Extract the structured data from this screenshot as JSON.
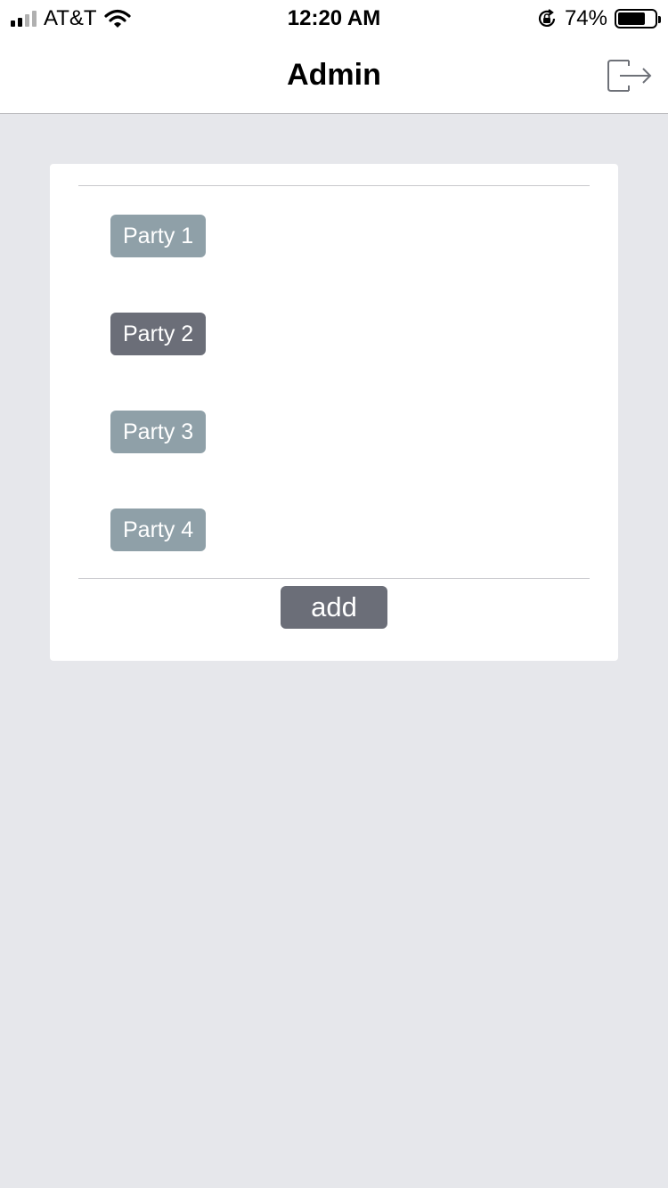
{
  "status_bar": {
    "carrier": "AT&T",
    "time": "12:20 AM",
    "battery_percent": "74%",
    "battery_level": 0.74,
    "icons": [
      "signal-icon",
      "wifi-icon",
      "rotation-lock-icon",
      "battery-icon"
    ]
  },
  "nav": {
    "title": "Admin",
    "logout_icon": "logout-icon"
  },
  "parties": [
    {
      "label": "Party 1",
      "selected": false
    },
    {
      "label": "Party 2",
      "selected": true
    },
    {
      "label": "Party 3",
      "selected": false
    },
    {
      "label": "Party 4",
      "selected": false
    }
  ],
  "add_button": {
    "label": "add"
  },
  "colors": {
    "background": "#e6e7eb",
    "card": "#ffffff",
    "party_default": "#8fa0a8",
    "party_selected": "#6b6e78",
    "add_button": "#6b6e78",
    "icon_stroke": "#6e7178"
  }
}
